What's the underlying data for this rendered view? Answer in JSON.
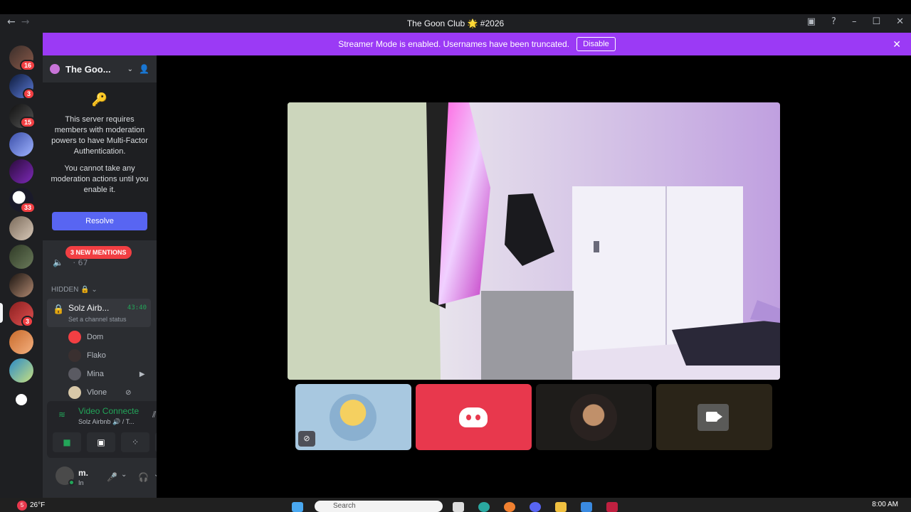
{
  "window": {
    "title": "The Goon Club 🌟 #2026",
    "back_icon": "←",
    "forward_icon": "→"
  },
  "banner": {
    "text": "Streamer Mode is enabled. Usernames have been truncated.",
    "disable_label": "Disable"
  },
  "rail": {
    "badges": [
      "16",
      "3",
      "15",
      "33",
      "3"
    ]
  },
  "server": {
    "name": "The Goo...",
    "mfa_text_1": "This server requires members with moderation powers to have Multi-Factor Authentication.",
    "mfa_text_2": "You cannot take any moderation actions until you enable it.",
    "resolve_label": "Resolve",
    "mentions_label": "3 NEW MENTIONS",
    "channel_count": "· 67",
    "category_label": "HIDDEN 🔒",
    "voice_channel": {
      "name": "Solz Airb...",
      "time": "43:40",
      "status": "Set a channel status"
    },
    "members": [
      {
        "name": "Dom"
      },
      {
        "name": "Flako"
      },
      {
        "name": "Mina"
      },
      {
        "name": "Vlone"
      }
    ]
  },
  "voice_panel": {
    "status": "Video Connecte",
    "subtitle": "Solz Airbnb 🔊 / T..."
  },
  "user": {
    "name": "m.",
    "state": "In"
  },
  "taskbar": {
    "weather_badge": "5",
    "weather": "26°F",
    "search_placeholder": "Search",
    "clock": "8:00 AM"
  },
  "colors": {
    "blurple": "#5865f2",
    "banner": "#9b3af5",
    "danger": "#f23f43",
    "online": "#23a559"
  }
}
